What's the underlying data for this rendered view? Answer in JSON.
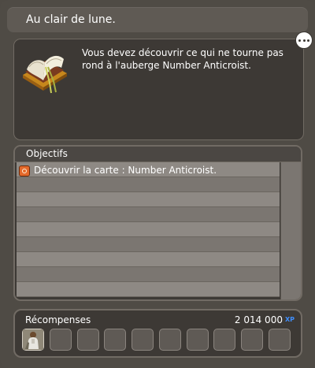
{
  "quest": {
    "title": "Au clair de lune.",
    "description": "Vous devez découvrir ce qui ne tourne pas rond à l'auberge Number Anticroist.",
    "icon": "open-book-icon"
  },
  "chat_button": {
    "icon": "speech-bubble-icon"
  },
  "objectives": {
    "header": "Objectifs",
    "items": [
      {
        "icon": "objective-marker-icon",
        "label": "Découvrir la carte : Number Anticroist."
      }
    ]
  },
  "rewards": {
    "label": "Récompenses",
    "xp_value": "2 014 000",
    "xp_unit": "XP",
    "slots": [
      {
        "filled": true,
        "icon": "character-avatar-icon"
      },
      {
        "filled": false
      },
      {
        "filled": false
      },
      {
        "filled": false
      },
      {
        "filled": false
      },
      {
        "filled": false
      },
      {
        "filled": false
      },
      {
        "filled": false
      },
      {
        "filled": false
      },
      {
        "filled": false
      },
      {
        "filled": false
      }
    ]
  },
  "colors": {
    "panel": "#4f4b45",
    "dark_box": "#3d3935",
    "row_light": "#8e8984",
    "row_dark": "#7b7671",
    "xp_accent": "#3f8fff",
    "objective_marker": "#e4692b"
  }
}
